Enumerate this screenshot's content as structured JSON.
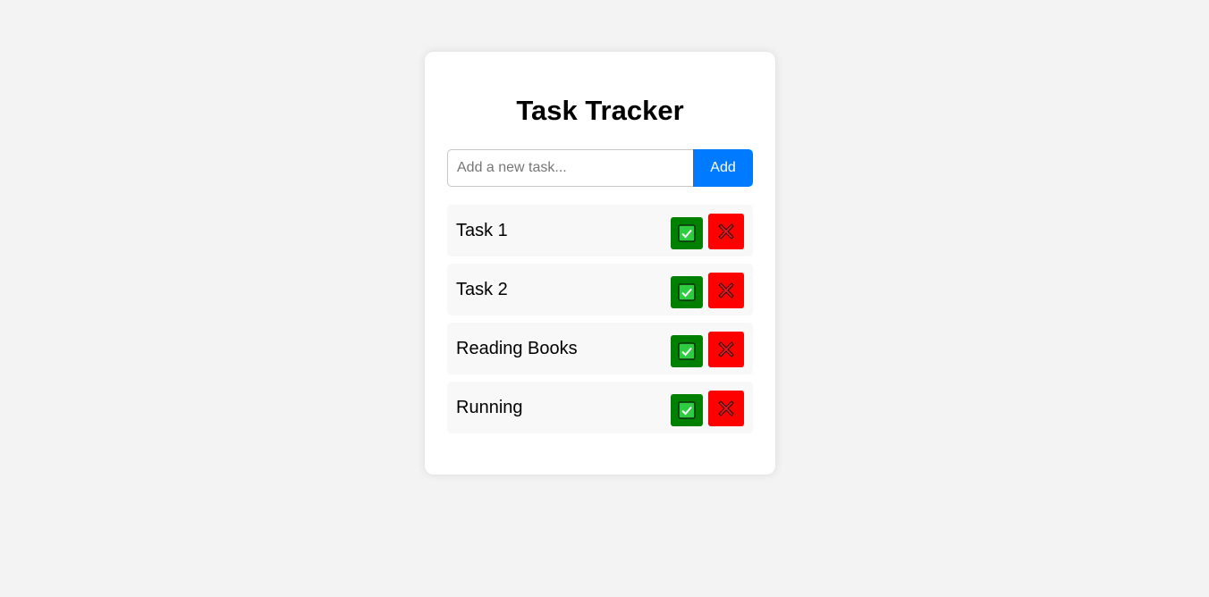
{
  "app": {
    "title": "Task Tracker"
  },
  "add_form": {
    "placeholder": "Add a new task...",
    "value": "",
    "add_label": "Add"
  },
  "tasks": [
    {
      "text": "Task 1"
    },
    {
      "text": "Task 2"
    },
    {
      "text": "Reading Books"
    },
    {
      "text": "Running"
    }
  ],
  "icons": {
    "complete": "check-box-icon",
    "delete": "cross-mark-icon"
  },
  "colors": {
    "accent": "#007bff",
    "complete": "#008000",
    "delete": "#ff0000",
    "background": "#f3f3f3",
    "card": "#ffffff",
    "task_bg": "#f8f8f8"
  }
}
